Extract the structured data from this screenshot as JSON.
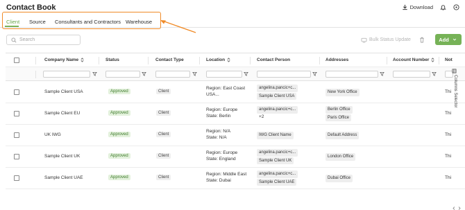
{
  "header": {
    "title": "Contact Book",
    "download_label": "Download"
  },
  "tabs": [
    {
      "label": "Client",
      "active": true
    },
    {
      "label": "Source",
      "active": false
    },
    {
      "label": "Consultants and Contractors",
      "active": false
    },
    {
      "label": "Warehouse",
      "active": false
    }
  ],
  "toolbar": {
    "search_placeholder": "Search",
    "bulk_label": "Bulk Status Update",
    "add_label": "Add"
  },
  "table": {
    "columns": [
      "Company Name",
      "Status",
      "Contact Type",
      "Location",
      "Contact Person",
      "Addresses",
      "Account Number",
      "Not"
    ],
    "rows": [
      {
        "company": "Sample Client USA",
        "status": "Approved",
        "type": "Client",
        "location_1": "Region: East Coast",
        "location_2": "USA...",
        "person_1": "angelina.pancic+c...",
        "person_2": "Sample Client USA",
        "address_1": "New York Office",
        "address_2": "",
        "note": "Thi"
      },
      {
        "company": "Sample Client EU",
        "status": "Approved",
        "type": "Client",
        "location_1": "Region: Europe",
        "location_2": "State: Berlin",
        "person_1": "angelina.pancic+c...",
        "person_2": "+2",
        "address_1": "Berlin Office",
        "address_2": "Paris Office",
        "note": "Thi"
      },
      {
        "company": "UK IWG",
        "status": "Approved",
        "type": "Client",
        "location_1": "Region: N/A",
        "location_2": "State: N/A",
        "person_1": "IWG Client Name",
        "person_2": "",
        "address_1": "Default Address",
        "address_2": "",
        "note": "Thi"
      },
      {
        "company": "Sample Client UK",
        "status": "Approved",
        "type": "Client",
        "location_1": "Region: Europe",
        "location_2": "State: England",
        "person_1": "angelina.pancic+c...",
        "person_2": "Sample Client UK",
        "address_1": "London Office",
        "address_2": "",
        "note": "Thi"
      },
      {
        "company": "Sample Client UAE",
        "status": "Approved",
        "type": "Client",
        "location_1": "Region: Middle East",
        "location_2": "State: Dubai",
        "person_1": "angelina.pancic+c...",
        "person_2": "Sample Client UAE",
        "address_1": "Dubai Office",
        "address_2": "",
        "note": "Thi"
      }
    ]
  },
  "column_selector_label": "Columns Selector",
  "colors": {
    "accent": "#76b257",
    "highlight": "#f08a26",
    "approved_bg": "#e3f1dc",
    "approved_text": "#3e7b2b"
  },
  "icons": [
    "download-icon",
    "bell-icon",
    "help-icon",
    "search-icon",
    "bulk-status-icon",
    "trash-icon",
    "chevron-down-icon",
    "sort-icon",
    "filter-icon"
  ]
}
